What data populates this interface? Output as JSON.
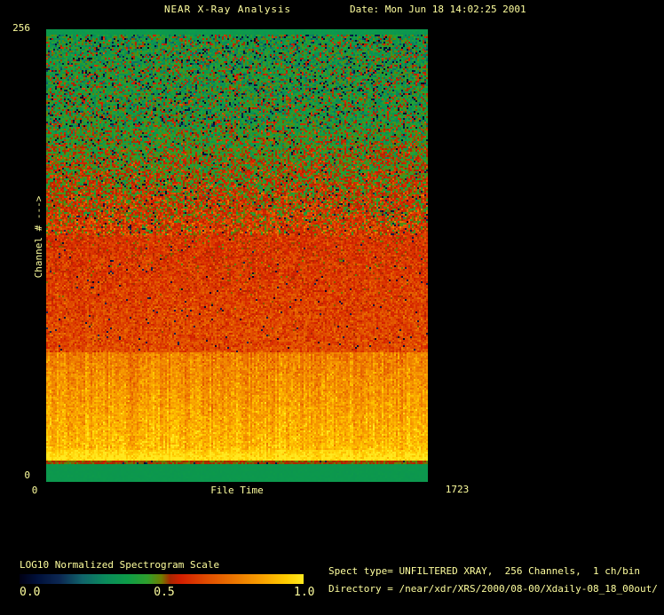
{
  "header": {
    "title": "NEAR X-Ray Analysis",
    "date_label": "Date: Mon Jun 18 14:02:25 2001"
  },
  "plot": {
    "y_axis": {
      "label": "Channel # --->",
      "tick_max": "256",
      "tick_min": "0"
    },
    "x_axis": {
      "label": "File Time",
      "tick_min": "0",
      "tick_max": "1723"
    }
  },
  "colorbar": {
    "title": "LOG10 Normalized Spectrogram Scale",
    "ticks": [
      "0.0",
      "0.5",
      "1.0"
    ]
  },
  "info": {
    "spect_type_line": "Spect type= UNFILTERED XRAY,  256 Channels,  1 ch/bin",
    "directory_line": "Directory = /near/xdr/XRS/2000/08-00/Xdaily-08_18_00out/"
  },
  "colors": {
    "background": "#000000",
    "text": "#ffff9e"
  },
  "chart_data": {
    "type": "heatmap",
    "title": "NEAR X-Ray Analysis",
    "xlabel": "File Time",
    "ylabel": "Channel # --->",
    "xlim": [
      0,
      1723
    ],
    "ylim": [
      0,
      256
    ],
    "scale_label": "LOG10 Normalized Spectrogram Scale",
    "scale_ticks": [
      0.0,
      0.5,
      1.0
    ],
    "grid": false,
    "legend_position": "bottom-left-colorbar",
    "colormap_stops": [
      [
        0.0,
        "#000014"
      ],
      [
        0.06,
        "#00103a"
      ],
      [
        0.14,
        "#0c2752"
      ],
      [
        0.22,
        "#10636a"
      ],
      [
        0.3,
        "#0a8a5c"
      ],
      [
        0.38,
        "#0d9c48"
      ],
      [
        0.45,
        "#2f9f2c"
      ],
      [
        0.5,
        "#6f7d00"
      ],
      [
        0.53,
        "#a82600"
      ],
      [
        0.57,
        "#d41f00"
      ],
      [
        0.66,
        "#e04c00"
      ],
      [
        0.76,
        "#ec7700"
      ],
      [
        0.86,
        "#f9a300"
      ],
      [
        0.94,
        "#ffcc00"
      ],
      [
        1.0,
        "#ffe81e"
      ]
    ],
    "bands": [
      {
        "ch_from": 0,
        "ch_to": 11,
        "value_from": 0.36,
        "value_to": 0.36,
        "sigma": 0.004,
        "streak": 0.0,
        "speckle": 0.0
      },
      {
        "ch_from": 11,
        "ch_to": 13,
        "value_from": 0.52,
        "value_to": 0.52,
        "sigma": 0.02,
        "streak": 0.0,
        "speckle": 0.03
      },
      {
        "ch_from": 13,
        "ch_to": 19,
        "value_from": 1.0,
        "value_to": 0.94,
        "sigma": 0.035,
        "streak": 0.6,
        "speckle": 0.0
      },
      {
        "ch_from": 19,
        "ch_to": 74,
        "value_from": 0.91,
        "value_to": 0.77,
        "sigma": 0.045,
        "streak": 1.0,
        "speckle": 0.0
      },
      {
        "ch_from": 74,
        "ch_to": 140,
        "value_from": 0.66,
        "value_to": 0.6,
        "sigma": 0.05,
        "streak": 0.2,
        "speckle": 0.012
      },
      {
        "ch_from": 140,
        "ch_to": 200,
        "value_from": 0.6,
        "value_to": 0.44,
        "sigma": 0.085,
        "streak": 0.0,
        "speckle": 0.035
      },
      {
        "ch_from": 200,
        "ch_to": 253,
        "value_from": 0.43,
        "value_to": 0.4,
        "sigma": 0.095,
        "streak": 0.0,
        "speckle": 0.07
      },
      {
        "ch_from": 253,
        "ch_to": 256,
        "value_from": 0.36,
        "value_to": 0.36,
        "sigma": 0.01,
        "streak": 0.0,
        "speckle": 0.0
      }
    ]
  }
}
